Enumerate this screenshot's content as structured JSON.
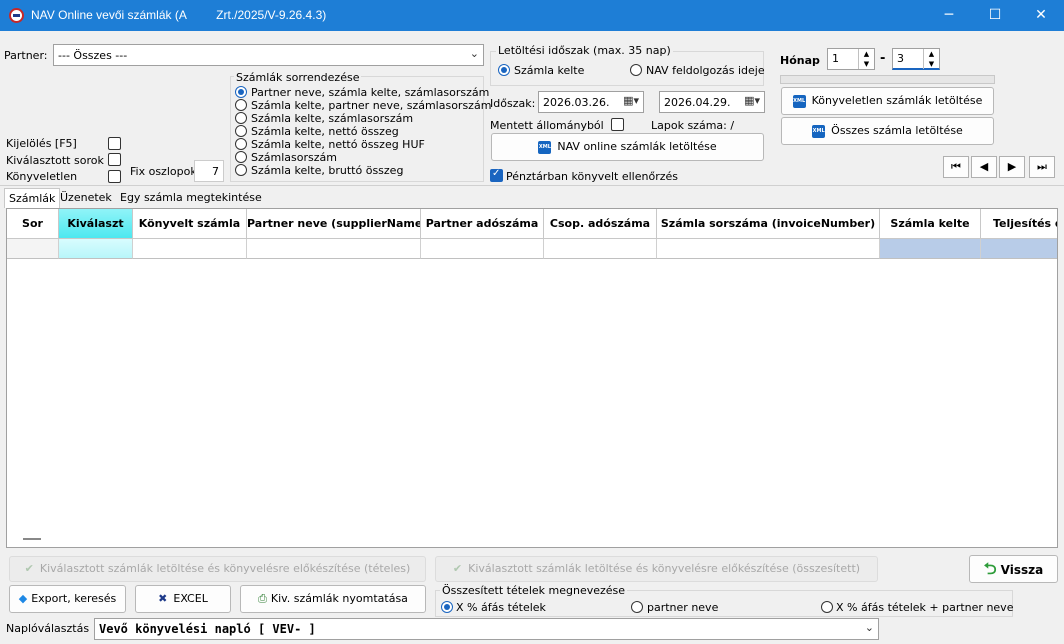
{
  "window": {
    "title": "NAV Online vevői számlák (A         Zrt./2025/V-9.26.4.3)",
    "minimize": "─",
    "maximize": "☐",
    "close": "✕"
  },
  "partner": {
    "label": "Partner:",
    "value": "--- Összes ---"
  },
  "left_options": {
    "kijeloles": "Kijelölés [F5]",
    "kivalasztott_sorok": "Kiválasztott sorok",
    "konyveletlen": "Könyveletlen",
    "fix_oszlopok_label": "Fix oszlopok",
    "fix_oszlopok_value": "7"
  },
  "sort": {
    "title": "Számlák sorrendezése",
    "options": [
      "Partner neve, számla kelte, számlasorszám",
      "Számla kelte, partner neve, számlasorszám",
      "Számla kelte, számlasorszám",
      "Számla kelte, nettó összeg",
      "Számla kelte, nettó összeg HUF",
      "Számlasorszám",
      "Számla kelte, bruttó összeg"
    ],
    "selected_index": 0
  },
  "download_period": {
    "title": "Letöltési időszak (max. 35 nap)",
    "option_invoice_date": "Számla kelte",
    "option_nav_date": "NAV feldolgozás ideje",
    "idoszak_label": "Időszak:",
    "date_from": "2026.03.26.",
    "date_to": "2026.04.29.",
    "saved_file_label": "Mentett állományból",
    "pages_label": "Lapok száma: /",
    "nav_download_button": "NAV online számlák letöltése",
    "cash_check_label": "Pénztárban könyvelt ellenőrzés"
  },
  "month": {
    "label": "Hónap",
    "from": "1",
    "dash": "-",
    "to": "3",
    "unbooked_button": "Könyveletlen számlák letöltése",
    "all_button": "Összes számla letöltése"
  },
  "record_nav": {
    "first": "⏮",
    "prev": "◀",
    "next": "▶",
    "last": "⏭"
  },
  "tabs": [
    "Számlák",
    "Üzenetek",
    "Egy számla megtekintése"
  ],
  "grid": {
    "columns": [
      "Sor",
      "Kiválaszt",
      "Könyvelt számla",
      "Partner neve (supplierName)",
      "Partner adószáma",
      "Csop. adószáma",
      "Számla sorszáma (invoiceNumber)",
      "Számla kelte",
      "Teljesítés d"
    ]
  },
  "bottom": {
    "prepare_itemized": "Kiválasztott számlák letöltése és könyvelésre előkészítése (tételes)",
    "prepare_summary": "Kiválasztott számlák letöltése és könyvelésre előkészítése (összesített)",
    "back_button": "Vissza",
    "export_button": "Export, keresés",
    "excel_button": "EXCEL",
    "print_button": "Kiv. számlák nyomtatása",
    "summary_group_title": "Összesített tételek megnevezése",
    "summary_options": [
      "X % áfás tételek",
      "partner neve",
      "X % áfás tételek + partner neve"
    ],
    "summary_selected": 0,
    "journal_label": "Naplóválasztás",
    "journal_value": "Vevő könyvelési napló [ VEV- ]"
  },
  "colors": {
    "titlebar": "#1e7ed6",
    "accent": "#1a65c0",
    "selected_header": "#4de8f0",
    "date_column": "#b8cce8"
  }
}
